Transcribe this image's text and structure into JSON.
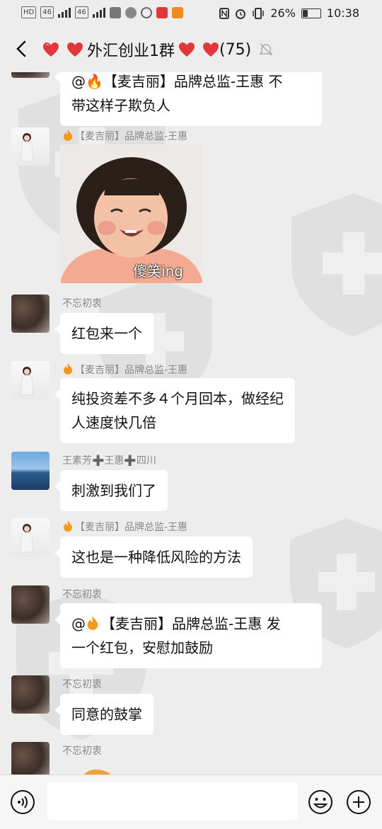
{
  "status_bar": {
    "left_chips": [
      "HD",
      "46",
      "46"
    ],
    "battery_percent": "26%",
    "time": "10:38"
  },
  "header": {
    "title_text": "外汇创业1群",
    "member_count": "(75)",
    "accent_heart_color": "#e0383a"
  },
  "messages": [
    {
      "type": "text",
      "avatar": "food",
      "sender": "",
      "text_line1": "@🔥【麦吉丽】品牌总监-王惠  不",
      "text_line2": "带这样子欺负人"
    },
    {
      "type": "sticker",
      "avatar": "woman",
      "sender": "【麦吉丽】品牌总监-王惠",
      "sticker_caption": "傻笑ing"
    },
    {
      "type": "text",
      "avatar": "food",
      "sender": "不忘初衷",
      "text": "红包来一个"
    },
    {
      "type": "text",
      "avatar": "woman",
      "sender": "【麦吉丽】品牌总监-王惠",
      "text_line1": "纯投资差不多４个月回本，做经纪",
      "text_line2": "人速度快几倍"
    },
    {
      "type": "text",
      "avatar": "sea",
      "sender": "王素芳➕王惠➕四川",
      "text": "刺激到我们了"
    },
    {
      "type": "text",
      "avatar": "woman",
      "sender": "【麦吉丽】品牌总监-王惠",
      "text": "这也是一种降低风险的方法"
    },
    {
      "type": "text",
      "avatar": "food",
      "sender": "不忘初衷",
      "text_line1": "【麦吉丽】品牌总监-王惠  发",
      "text_line2": "一个红包，安慰加鼓励"
    },
    {
      "type": "text",
      "avatar": "food",
      "sender": "不忘初衷",
      "text": "同意的鼓掌"
    },
    {
      "type": "partial",
      "avatar": "food",
      "sender": "不忘初衷"
    }
  ],
  "input_bar": {
    "value": "",
    "icons": [
      "voice-icon",
      "emoji-icon",
      "plus-icon"
    ]
  }
}
